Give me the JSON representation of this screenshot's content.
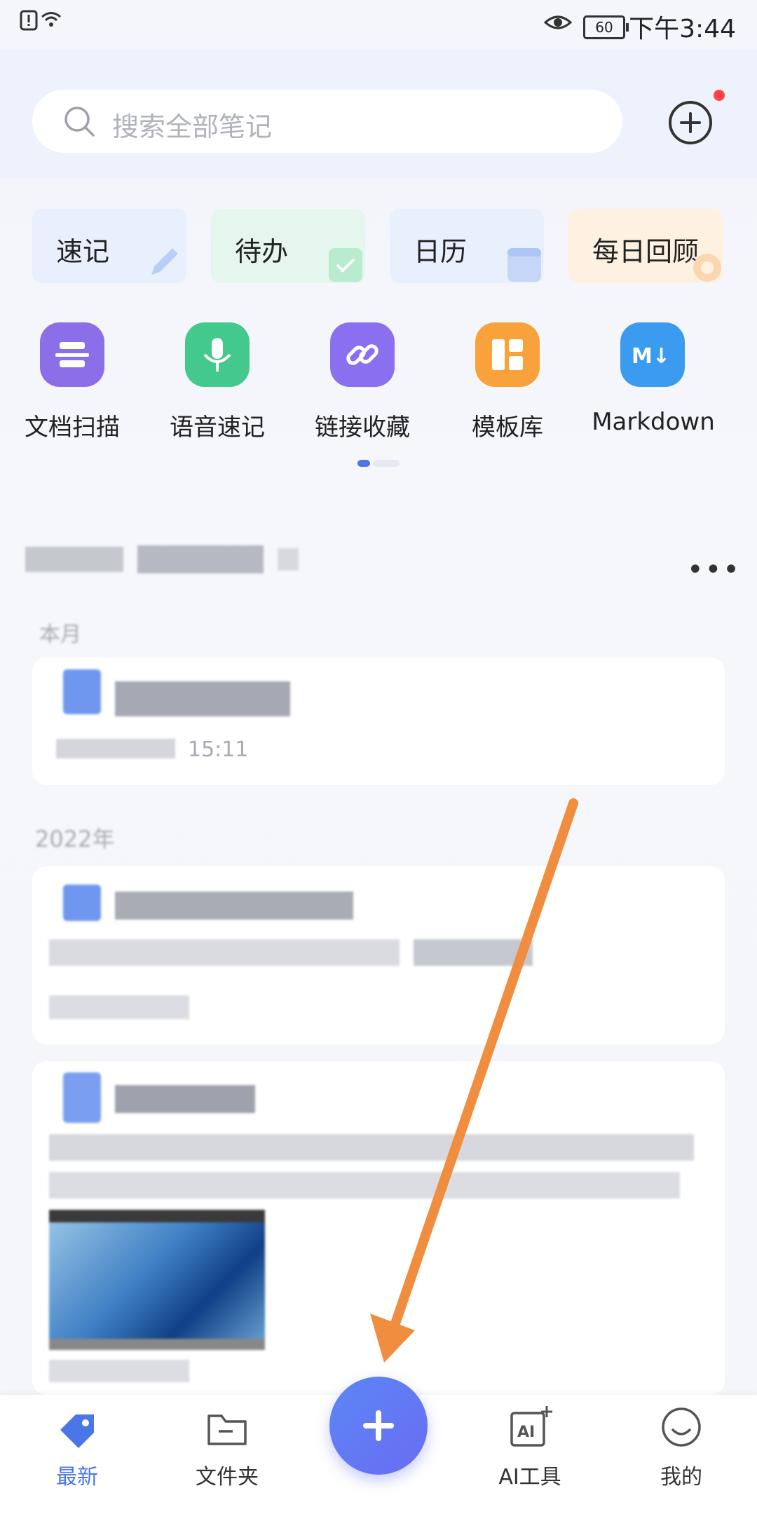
{
  "status_bar": {
    "time": "下午3:44",
    "battery": "60"
  },
  "search": {
    "placeholder": "搜索全部笔记"
  },
  "quick_cards": [
    {
      "label": "速记",
      "color": "#e8f0fd"
    },
    {
      "label": "待办",
      "color": "#e4f6ed"
    },
    {
      "label": "日历",
      "color": "#e9f0fd"
    },
    {
      "label": "每日回顾",
      "color": "#fff1e2"
    }
  ],
  "features": [
    {
      "label": "文档扫描",
      "icon": "document-scan-icon",
      "color": "#8b6fe8"
    },
    {
      "label": "语音速记",
      "icon": "microphone-icon",
      "color": "#43c98c"
    },
    {
      "label": "链接收藏",
      "icon": "link-icon",
      "color": "#8a6ff0"
    },
    {
      "label": "模板库",
      "icon": "template-icon",
      "color": "#f9a23c"
    },
    {
      "label": "Markdown",
      "icon": "markdown-icon",
      "color": "#3a9bef"
    }
  ],
  "notes_section": {
    "month_label": "本月",
    "year_label": "2022年",
    "first_note_time": "15:11"
  },
  "bottom_nav": [
    {
      "label": "最新",
      "icon": "latest-icon",
      "active": true
    },
    {
      "label": "文件夹",
      "icon": "folder-icon",
      "active": false
    },
    {
      "label": "AI工具",
      "icon": "ai-tools-icon",
      "active": false
    },
    {
      "label": "我的",
      "icon": "profile-icon",
      "active": false
    }
  ],
  "colors": {
    "accent": "#4a76e8",
    "fab": "#5f7af4",
    "annotation_arrow": "#f08d3f"
  }
}
